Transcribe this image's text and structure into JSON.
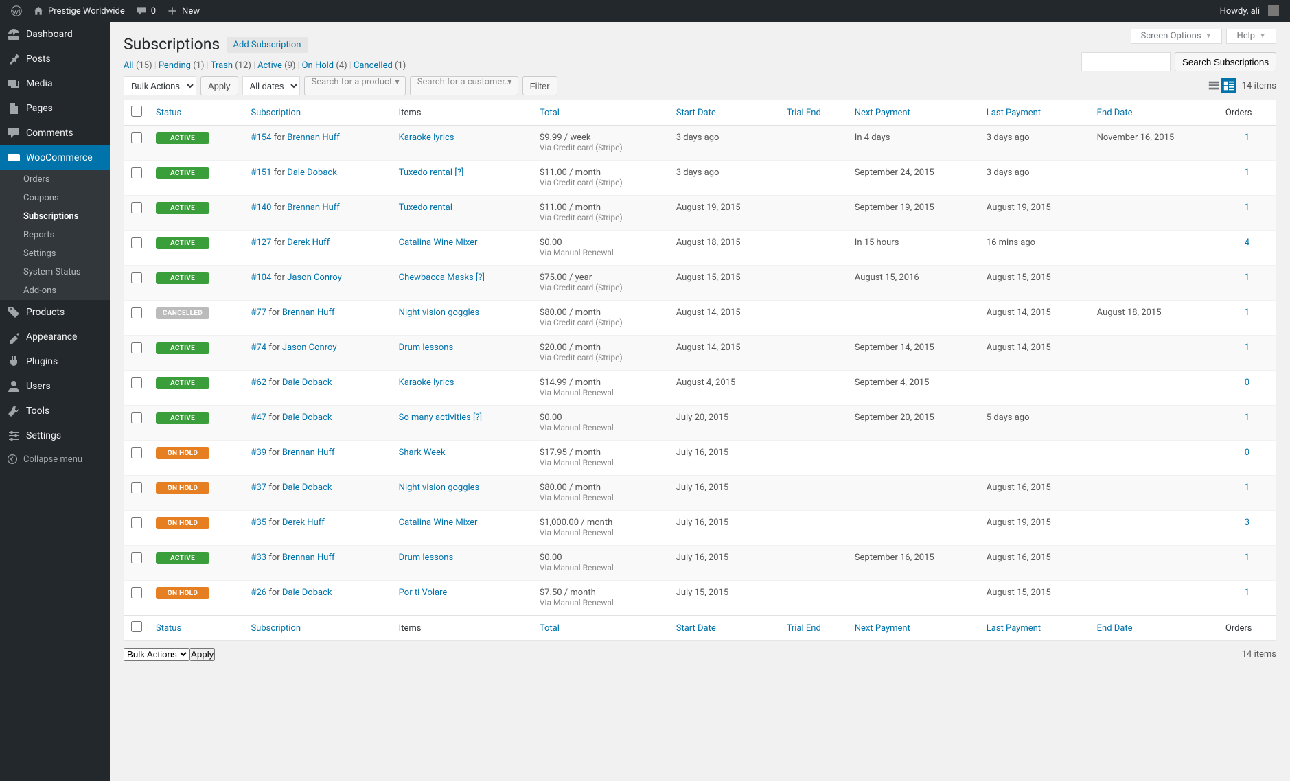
{
  "adminbar": {
    "site_name": "Prestige Worldwide",
    "comments_count": "0",
    "new_label": "New",
    "howdy": "Howdy, ali"
  },
  "menu": {
    "items": [
      {
        "label": "Dashboard",
        "icon": "dashboard"
      },
      {
        "label": "Posts",
        "icon": "pin"
      },
      {
        "label": "Media",
        "icon": "media"
      },
      {
        "label": "Pages",
        "icon": "pages"
      },
      {
        "label": "Comments",
        "icon": "comments"
      },
      {
        "label": "WooCommerce",
        "icon": "woo",
        "current": true,
        "submenu": [
          "Orders",
          "Coupons",
          "Subscriptions",
          "Reports",
          "Settings",
          "System Status",
          "Add-ons"
        ],
        "sub_current": "Subscriptions"
      },
      {
        "label": "Products",
        "icon": "products"
      },
      {
        "label": "Appearance",
        "icon": "appearance"
      },
      {
        "label": "Plugins",
        "icon": "plugins"
      },
      {
        "label": "Users",
        "icon": "users"
      },
      {
        "label": "Tools",
        "icon": "tools"
      },
      {
        "label": "Settings",
        "icon": "settings"
      }
    ],
    "collapse_label": "Collapse menu"
  },
  "screen_links": {
    "screen_options": "Screen Options",
    "help": "Help"
  },
  "page": {
    "title": "Subscriptions",
    "add_button": "Add Subscription"
  },
  "filters": {
    "views": [
      {
        "label": "All",
        "count": "(15)"
      },
      {
        "label": "Pending",
        "count": "(1)"
      },
      {
        "label": "Trash",
        "count": "(12)"
      },
      {
        "label": "Active",
        "count": "(9)"
      },
      {
        "label": "On Hold",
        "count": "(4)"
      },
      {
        "label": "Cancelled",
        "count": "(1)"
      }
    ],
    "bulk_label": "Bulk Actions",
    "apply_label": "Apply",
    "date_label": "All dates",
    "search_product_placeholder": "Search for a product…",
    "search_customer_placeholder": "Search for a customer…",
    "filter_label": "Filter",
    "items_count": "14 items",
    "search_button": "Search Subscriptions"
  },
  "columns": [
    "Status",
    "Subscription",
    "Items",
    "Total",
    "Start Date",
    "Trial End",
    "Next Payment",
    "Last Payment",
    "End Date",
    "Orders"
  ],
  "rows": [
    {
      "status": "ACTIVE",
      "status_class": "active",
      "id": "154",
      "for": "for",
      "customer": "Brennan Huff",
      "items": "Karaoke lyrics",
      "total": "$9.99 / week",
      "via": "Via Credit card (Stripe)",
      "start": "3 days ago",
      "trial": "–",
      "next": "In 4 days",
      "last": "3 days ago",
      "end": "November 16, 2015",
      "orders": "1"
    },
    {
      "status": "ACTIVE",
      "status_class": "active",
      "id": "151",
      "for": "for",
      "customer": "Dale Doback",
      "items": "Tuxedo rental [?]",
      "total": "$11.00 / month",
      "via": "Via Credit card (Stripe)",
      "start": "3 days ago",
      "trial": "–",
      "next": "September 24, 2015",
      "last": "3 days ago",
      "end": "–",
      "orders": "1"
    },
    {
      "status": "ACTIVE",
      "status_class": "active",
      "id": "140",
      "for": "for",
      "customer": "Brennan Huff",
      "items": "Tuxedo rental",
      "total": "$11.00 / month",
      "via": "Via Credit card (Stripe)",
      "start": "August 19, 2015",
      "trial": "–",
      "next": "September 19, 2015",
      "last": "August 19, 2015",
      "end": "–",
      "orders": "1"
    },
    {
      "status": "ACTIVE",
      "status_class": "active",
      "id": "127",
      "for": "for",
      "customer": "Derek Huff",
      "items": "Catalina Wine Mixer",
      "total": "$0.00",
      "via": "Via Manual Renewal",
      "start": "August 18, 2015",
      "trial": "–",
      "next": "In 15 hours",
      "last": "16 mins ago",
      "end": "–",
      "orders": "4"
    },
    {
      "status": "ACTIVE",
      "status_class": "active",
      "id": "104",
      "for": "for",
      "customer": "Jason Conroy",
      "items": "Chewbacca Masks [?]",
      "total": "$75.00 / year",
      "via": "Via Credit card (Stripe)",
      "start": "August 15, 2015",
      "trial": "–",
      "next": "August 15, 2016",
      "last": "August 15, 2015",
      "end": "–",
      "orders": "1"
    },
    {
      "status": "CANCELLED",
      "status_class": "cancelled",
      "id": "77",
      "for": "for",
      "customer": "Brennan Huff",
      "items": "Night vision goggles",
      "total": "$80.00 / month",
      "via": "Via Credit card (Stripe)",
      "start": "August 14, 2015",
      "trial": "–",
      "next": "–",
      "last": "August 14, 2015",
      "end": "August 18, 2015",
      "orders": "1"
    },
    {
      "status": "ACTIVE",
      "status_class": "active",
      "id": "74",
      "for": "for",
      "customer": "Jason Conroy",
      "items": "Drum lessons",
      "total": "$20.00 / month",
      "via": "Via Credit card (Stripe)",
      "start": "August 14, 2015",
      "trial": "–",
      "next": "September 14, 2015",
      "last": "August 14, 2015",
      "end": "–",
      "orders": "1"
    },
    {
      "status": "ACTIVE",
      "status_class": "active",
      "id": "62",
      "for": "for",
      "customer": "Dale Doback",
      "items": "Karaoke lyrics",
      "total": "$14.99 / month",
      "via": "Via Manual Renewal",
      "start": "August 4, 2015",
      "trial": "–",
      "next": "September 4, 2015",
      "last": "–",
      "end": "–",
      "orders": "0"
    },
    {
      "status": "ACTIVE",
      "status_class": "active",
      "id": "47",
      "for": "for",
      "customer": "Dale Doback",
      "items": "So many activities [?]",
      "total": "$0.00",
      "via": "Via Manual Renewal",
      "start": "July 20, 2015",
      "trial": "–",
      "next": "September 20, 2015",
      "last": "5 days ago",
      "end": "–",
      "orders": "1"
    },
    {
      "status": "ON HOLD",
      "status_class": "on-hold",
      "id": "39",
      "for": "for",
      "customer": "Brennan Huff",
      "items": "Shark Week",
      "total": "$17.95 / month",
      "via": "Via Manual Renewal",
      "start": "July 16, 2015",
      "trial": "–",
      "next": "–",
      "last": "–",
      "end": "–",
      "orders": "0"
    },
    {
      "status": "ON HOLD",
      "status_class": "on-hold",
      "id": "37",
      "for": "for",
      "customer": "Dale Doback",
      "items": "Night vision goggles",
      "total": "$80.00 / month",
      "via": "Via Manual Renewal",
      "start": "July 16, 2015",
      "trial": "–",
      "next": "–",
      "last": "August 16, 2015",
      "end": "–",
      "orders": "1"
    },
    {
      "status": "ON HOLD",
      "status_class": "on-hold",
      "id": "35",
      "for": "for",
      "customer": "Derek Huff",
      "items": "Catalina Wine Mixer",
      "total": "$1,000.00 / month",
      "via": "Via Manual Renewal",
      "start": "July 16, 2015",
      "trial": "–",
      "next": "–",
      "last": "August 19, 2015",
      "end": "–",
      "orders": "3"
    },
    {
      "status": "ACTIVE",
      "status_class": "active",
      "id": "33",
      "for": "for",
      "customer": "Brennan Huff",
      "items": "Drum lessons",
      "total": "$0.00",
      "via": "Via Manual Renewal",
      "start": "July 16, 2015",
      "trial": "–",
      "next": "September 16, 2015",
      "last": "August 16, 2015",
      "end": "–",
      "orders": "1"
    },
    {
      "status": "ON HOLD",
      "status_class": "on-hold",
      "id": "26",
      "for": "for",
      "customer": "Dale Doback",
      "items": "Por ti Volare",
      "total": "$7.50 / month",
      "via": "Via Manual Renewal",
      "start": "July 15, 2015",
      "trial": "–",
      "next": "–",
      "last": "August 15, 2015",
      "end": "–",
      "orders": "1"
    }
  ]
}
